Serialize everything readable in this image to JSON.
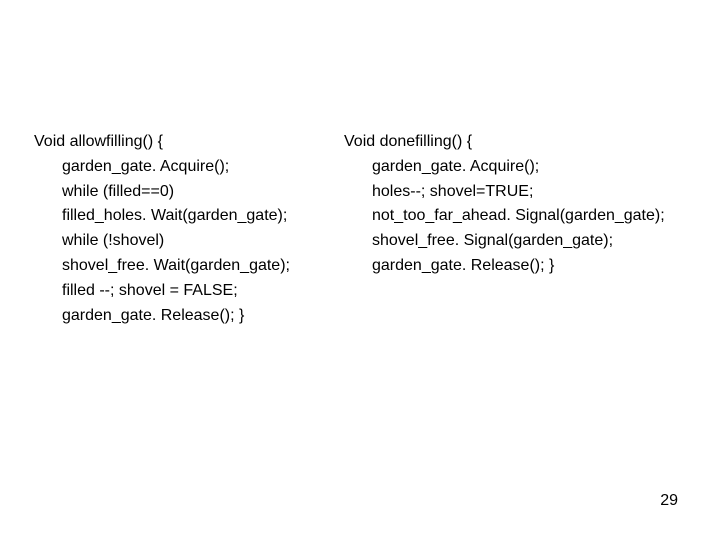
{
  "left": {
    "header": "Void allowfilling() {",
    "l1": "garden_gate. Acquire();",
    "l2": "while (filled==0)",
    "l3": "filled_holes. Wait(garden_gate);",
    "l4": "while (!shovel)",
    "l5": "shovel_free. Wait(garden_gate);",
    "l6": "filled --; shovel = FALSE;",
    "l7": "garden_gate. Release(); }"
  },
  "right": {
    "header": "Void donefilling() {",
    "l1": "garden_gate. Acquire();",
    "l2": "holes--; shovel=TRUE;",
    "l3": "not_too_far_ahead. Signal(garden_gate);",
    "l4": "shovel_free. Signal(garden_gate);",
    "l5": "garden_gate. Release(); }"
  },
  "page_number": "29"
}
